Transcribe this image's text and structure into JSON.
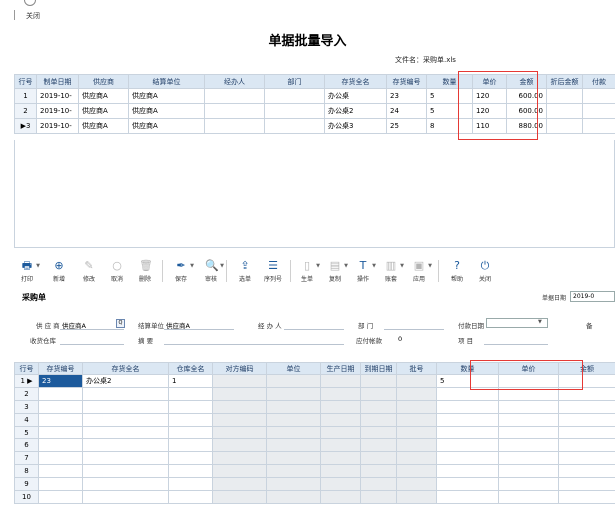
{
  "window": {
    "close_label": "关闭"
  },
  "title": "单据批量导入",
  "file_label": "文件名：采购单.xls",
  "grid1": {
    "headers": [
      "行号",
      "制单日期",
      "供应商",
      "结算单位",
      "经办人",
      "部门",
      "存货全名",
      "存货编号",
      "数量",
      "单价",
      "金额",
      "折后金额",
      "付款"
    ],
    "rows": [
      {
        "no": "1",
        "date": "2019-10-",
        "supplier": "供应商A",
        "settle": "供应商A",
        "handler": "",
        "dept": "",
        "item": "办公桌",
        "code": "23",
        "qty": "5",
        "price": "120",
        "amount": "600.00"
      },
      {
        "no": "2",
        "date": "2019-10-",
        "supplier": "供应商A",
        "settle": "供应商A",
        "handler": "",
        "dept": "",
        "item": "办公桌2",
        "code": "24",
        "qty": "5",
        "price": "120",
        "amount": "600.00"
      },
      {
        "no": "3",
        "date": "2019-10-",
        "supplier": "供应商A",
        "settle": "供应商A",
        "handler": "",
        "dept": "",
        "item": "办公桌3",
        "code": "25",
        "qty": "8",
        "price": "110",
        "amount": "880.00"
      }
    ]
  },
  "toolbar": {
    "print": "打印",
    "add": "新增",
    "modify": "修改",
    "cancel": "取消",
    "delete": "删除",
    "save": "保存",
    "audit": "审核",
    "select": "选单",
    "serial": "序列号",
    "gen": "生单",
    "copy": "复制",
    "operate": "操作",
    "ledger": "账套",
    "apply": "应用",
    "help": "帮助",
    "close": "关闭"
  },
  "form": {
    "title": "采购单",
    "date_label": "单据日期",
    "date_value": "2019-0",
    "supplier_label": "供 应 商",
    "supplier_value": "供应商A",
    "settle_label": "结算单位",
    "settle_value": "供应商A",
    "handler_label": "经 办 人",
    "dept_label": "部   门",
    "pay_date_label": "付款日期",
    "receiver_label": "收货仓库",
    "summary_label": "摘   要",
    "payable_label": "应付帐款",
    "payable_value": "0",
    "project_label": "项   目",
    "extra_label": "备"
  },
  "grid2": {
    "headers": [
      "行号",
      "存货编号",
      "存货全名",
      "仓库全名",
      "对方编码",
      "单位",
      "生产日期",
      "到期日期",
      "批号",
      "数量",
      "单价",
      "金额"
    ],
    "rows": [
      {
        "no": "1",
        "code": "23",
        "item": "办公桌2",
        "wh": "1",
        "qty": "5"
      },
      {
        "no": "2"
      },
      {
        "no": "3"
      },
      {
        "no": "4"
      },
      {
        "no": "5"
      },
      {
        "no": "6"
      },
      {
        "no": "7"
      },
      {
        "no": "8"
      },
      {
        "no": "9"
      },
      {
        "no": "10"
      }
    ]
  },
  "colors": {
    "highlight": "#e53935",
    "header_bg": "#dbe7f3",
    "accent": "#1c5a9c"
  }
}
